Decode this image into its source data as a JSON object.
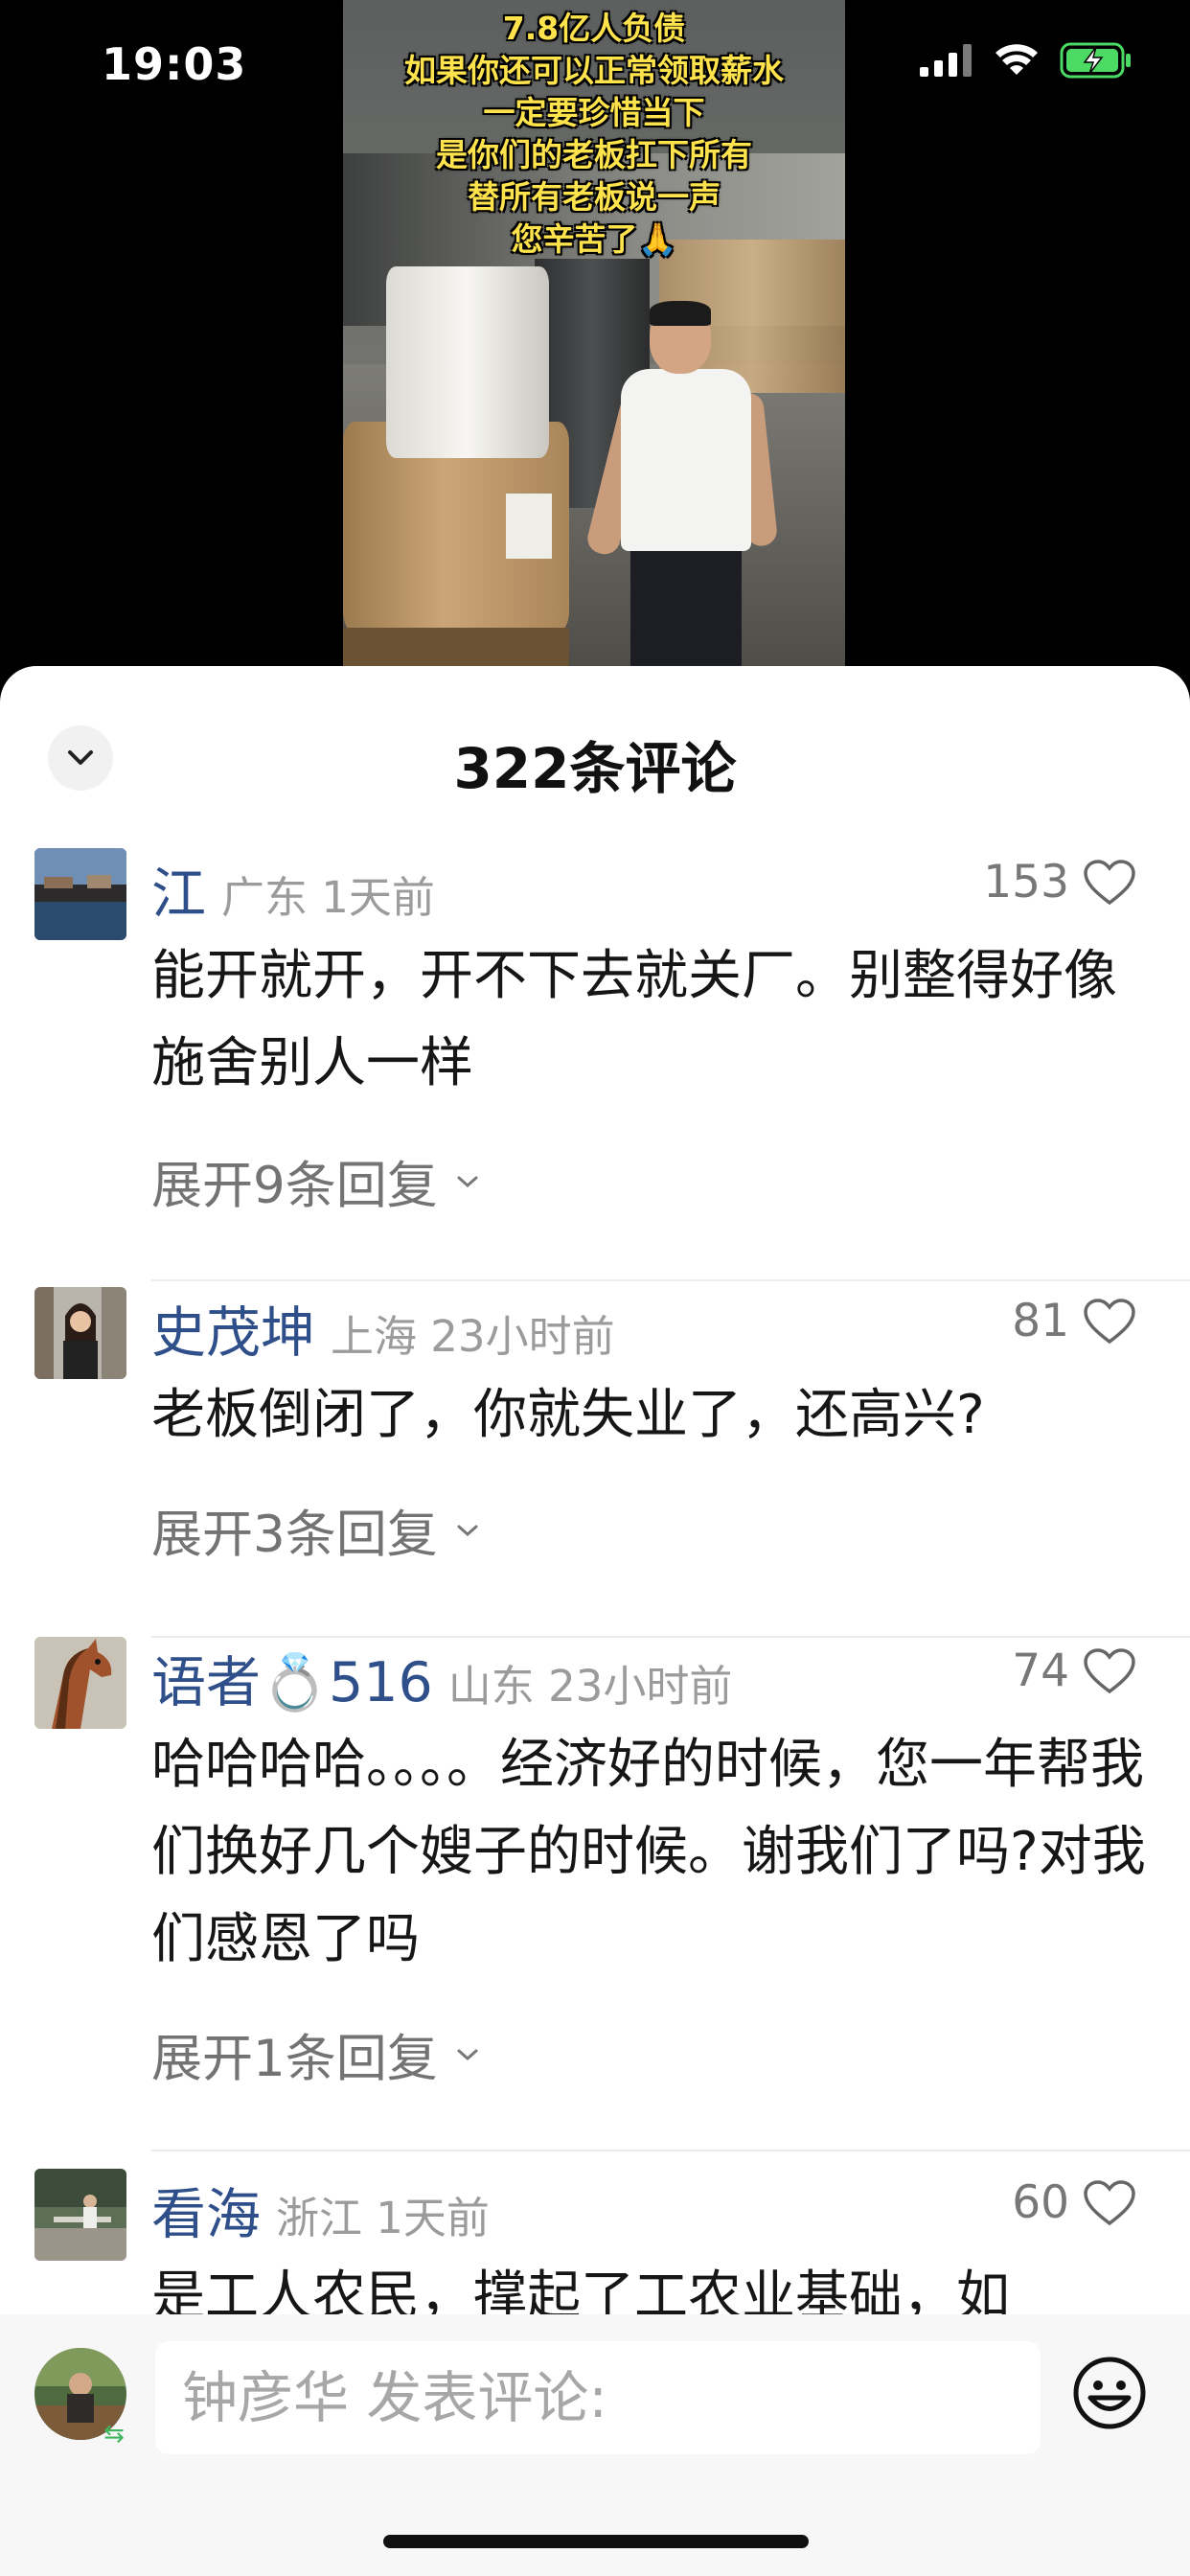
{
  "status_bar": {
    "time": "19:03",
    "battery_color": "#4cd964"
  },
  "video": {
    "overlay_lines": [
      "7.8亿人负债",
      "如果你还可以正常领取薪水",
      "一定要珍惜当下",
      "是你们的老板扛下所有",
      "替所有老板说一声",
      "您辛苦了🙏"
    ]
  },
  "sheet": {
    "title": "322条评论",
    "collapse_icon": "chevron-down-icon"
  },
  "comments": [
    {
      "name": "江",
      "meta": "广东 1天前",
      "likes": "153",
      "text": "能开就开，开不下去就关厂。别整得好像施舍别人一样",
      "expand": "展开9条回复"
    },
    {
      "name": "史茂坤",
      "meta": "上海 23小时前",
      "likes": "81",
      "text": "老板倒闭了，你就失业了，还高兴?",
      "expand": "展开3条回复"
    },
    {
      "name": "语者💍516",
      "meta": "山东 23小时前",
      "likes": "74",
      "text": "哈哈哈哈。。。。经济好的时候，您一年帮我们换好几个嫂子的时候。谢我们了吗?对我们感恩了吗",
      "expand": "展开1条回复"
    },
    {
      "name": "看海",
      "meta": "浙江 1天前",
      "likes": "60",
      "text": "是工人农民，撑起了工农业基础，如"
    }
  ],
  "input": {
    "placeholder": "钟彦华 发表评论:"
  },
  "colors": {
    "name_blue": "#2f4f8a",
    "meta_gray": "#9b9b9b",
    "overlay_yellow": "#ffe34d"
  }
}
